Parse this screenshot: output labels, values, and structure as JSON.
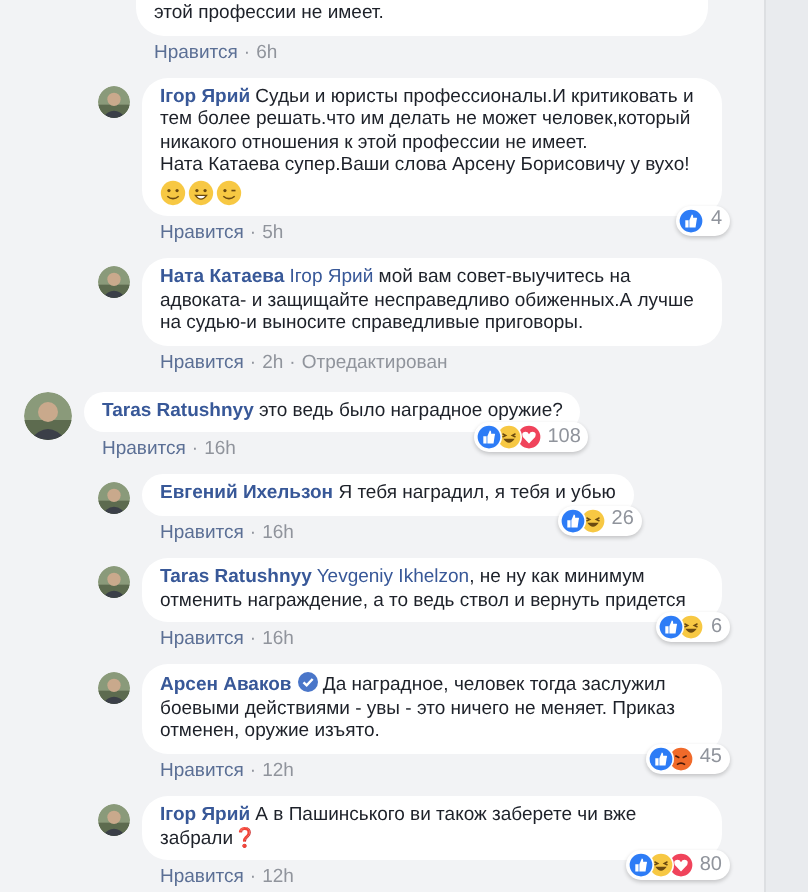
{
  "replies_above": [
    {
      "partial": true,
      "paragraphs": [
        "этой профессии не имеет."
      ],
      "actions": [
        "Нравится",
        "·",
        "6h"
      ]
    },
    {
      "author": "Ігор Ярий",
      "paragraphs": [
        "Судьи и юристы профессионалы.И критиковать и тем более решать.что им делать не может человек,который никакого отношения к этой профессии не имеет.",
        "Ната Катаева супер.Ваши слова Арсену Борисовичу у вухо!"
      ],
      "emoji": [
        {
          "kind": "smile"
        },
        {
          "kind": "grin"
        },
        {
          "kind": "wink"
        }
      ],
      "reactions": {
        "icons": [
          {
            "kind": "like"
          }
        ],
        "count": "4"
      },
      "actions": [
        "Нравится",
        "·",
        "5h"
      ]
    },
    {
      "author": "Ната Катаева",
      "mention": "Ігор Ярий",
      "paragraphs": [
        "мой вам совет-выучитесь на адвоката- и защищайте несправедливо обиженных.А лучше на судью-и выносите справедливые приговоры."
      ],
      "actions": [
        "Нравится",
        "·",
        "2h",
        "·",
        "Отредактирован"
      ]
    }
  ],
  "comment": {
    "author": "Taras Ratushnyy",
    "paragraphs": [
      "это ведь было наградное оружие?"
    ],
    "reactions": {
      "icons": [
        {
          "kind": "like"
        },
        {
          "kind": "haha"
        },
        {
          "kind": "love"
        }
      ],
      "count": "108"
    },
    "actions": [
      "Нравится",
      "·",
      "16h"
    ],
    "replies": [
      {
        "author": "Евгений Ихельзон",
        "paragraphs": [
          "Я тебя наградил, я тебя и убью"
        ],
        "reactions": {
          "icons": [
            {
              "kind": "like"
            },
            {
              "kind": "haha"
            }
          ],
          "count": "26"
        },
        "actions": [
          "Нравится",
          "·",
          "16h"
        ]
      },
      {
        "author": "Taras Ratushnyy",
        "mention": "Yevgeniy Ikhelzon",
        "paragraphs": [
          ", не ну как минимум отменить награждение, а то ведь ствол и вернуть придется"
        ],
        "reactions": {
          "icons": [
            {
              "kind": "like"
            },
            {
              "kind": "haha"
            }
          ],
          "count": "6"
        },
        "actions": [
          "Нравится",
          "·",
          "16h"
        ]
      },
      {
        "author": "Арсен Аваков",
        "verified": true,
        "paragraphs": [
          "Да наградное, человек тогда заслужил боевыми действиями - увы - это ничего не меняет. Приказ отменен, оружие изъято."
        ],
        "reactions": {
          "icons": [
            {
              "kind": "like"
            },
            {
              "kind": "angry"
            }
          ],
          "count": "45"
        },
        "actions": [
          "Нравится",
          "·",
          "12h"
        ]
      },
      {
        "author": "Ігор Ярий",
        "paragraphs": [
          "А в Пашинського ви також заберете чи вже забрали❓"
        ],
        "reactions": {
          "icons": [
            {
              "kind": "like"
            },
            {
              "kind": "haha"
            },
            {
              "kind": "love"
            }
          ],
          "count": "80"
        },
        "actions": [
          "Нравится",
          "·",
          "12h"
        ]
      }
    ]
  }
}
